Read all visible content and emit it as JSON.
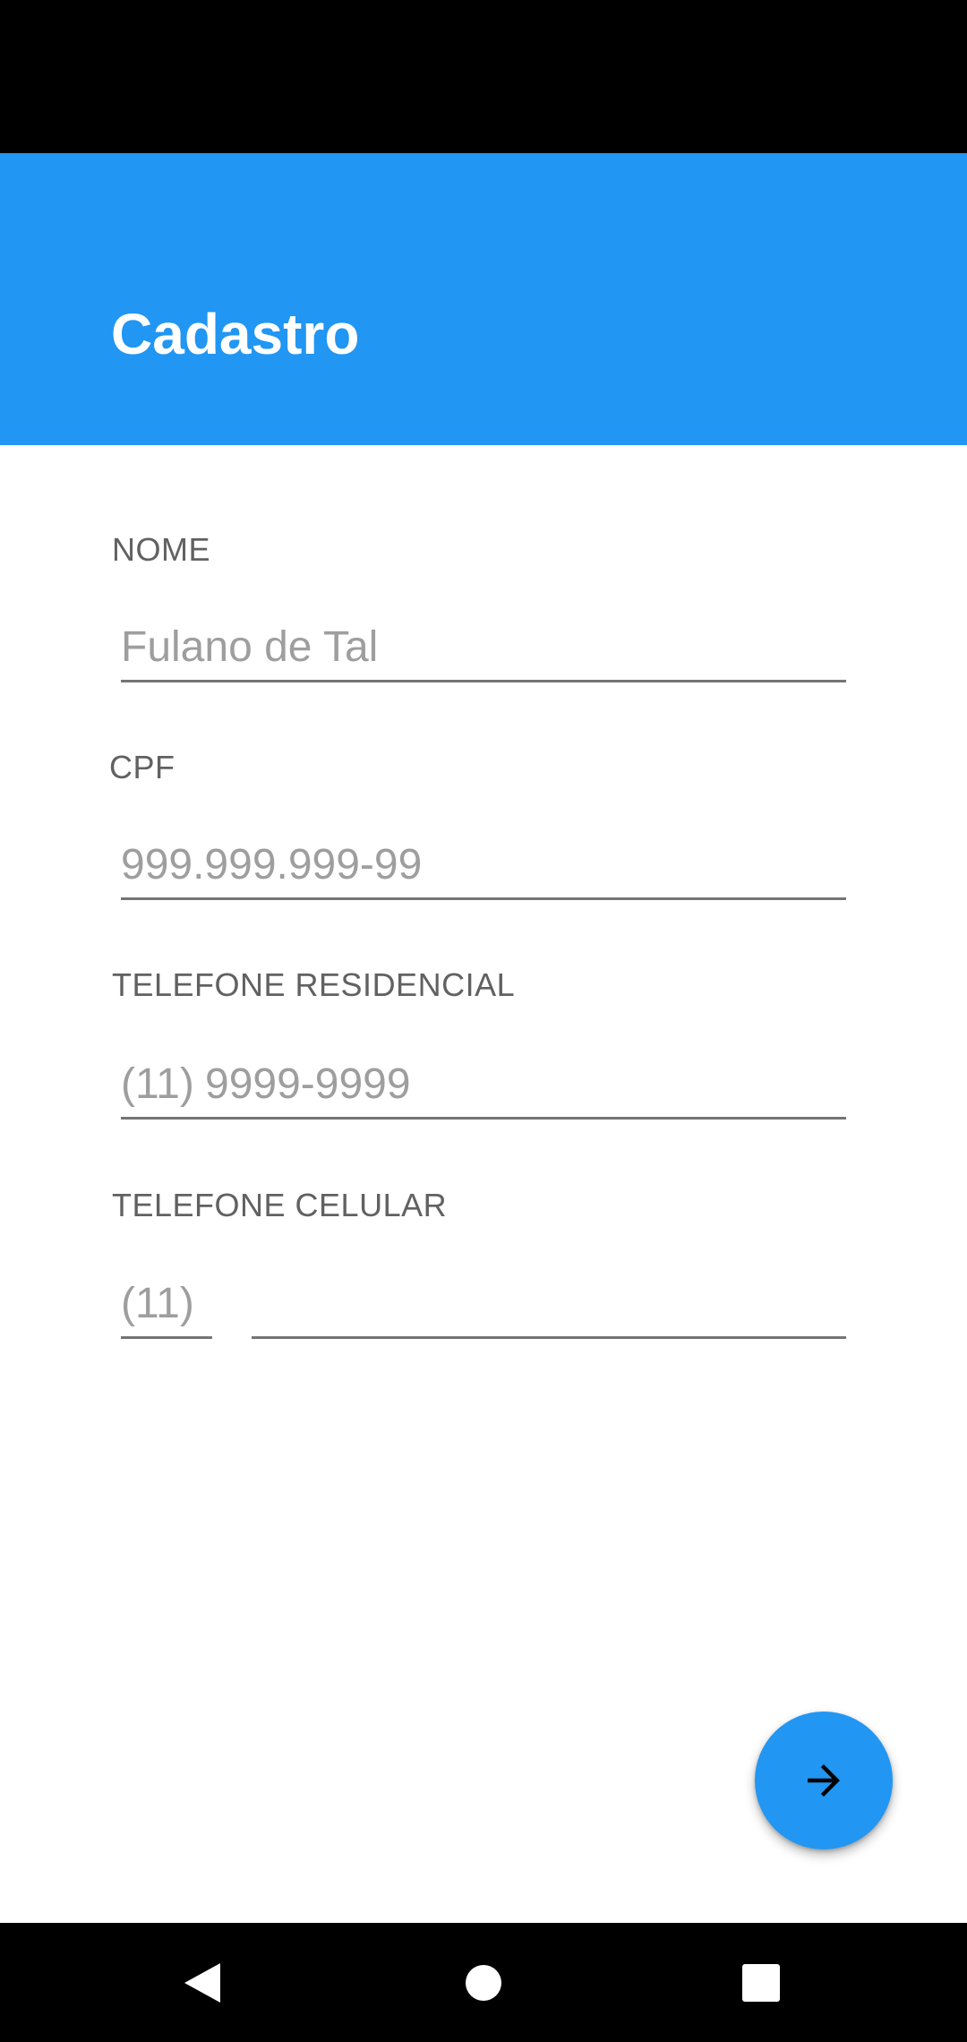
{
  "colors": {
    "primary": "#2196F3",
    "status_bar": "#000000",
    "nav_bar": "#000000",
    "label_text": "#616161",
    "placeholder_text": "#9e9e9e",
    "underline": "#757575"
  },
  "app_bar": {
    "title": "Cadastro"
  },
  "form": {
    "nome": {
      "label": "NOME",
      "value": "",
      "placeholder": "Fulano de Tal"
    },
    "cpf": {
      "label": "CPF",
      "value": "",
      "placeholder": "999.999.999-99"
    },
    "telefone_residencial": {
      "label": "TELEFONE RESIDENCIAL",
      "ddd_value": "",
      "ddd_placeholder": "(11)",
      "number_value": "",
      "number_placeholder": "9999-9999"
    },
    "telefone_celular": {
      "label": "TELEFONE CELULAR",
      "ddd_value": "",
      "ddd_placeholder": "(11)",
      "number_value": "",
      "number_placeholder": ""
    }
  },
  "fab": {
    "icon": "arrow-forward-icon"
  },
  "navigation_bar": {
    "back_icon": "back-triangle-icon",
    "home_icon": "home-circle-icon",
    "recents_icon": "recents-square-icon"
  }
}
